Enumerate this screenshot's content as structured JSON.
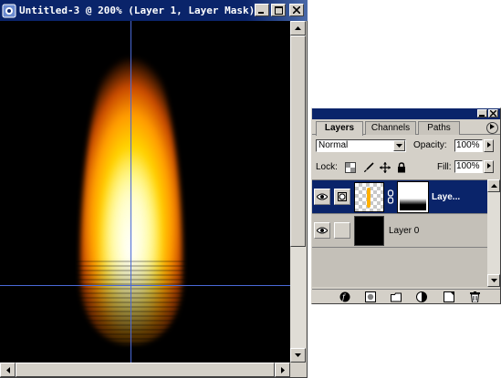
{
  "document": {
    "title": "Untitled-3 @ 200% (Layer 1, Layer Mask)",
    "minimize_glyph": "_",
    "maximize_glyph": "□",
    "close_glyph": "×"
  },
  "layers_panel": {
    "tabs": [
      {
        "label": "Layers",
        "active": true
      },
      {
        "label": "Channels",
        "active": false
      },
      {
        "label": "Paths",
        "active": false
      }
    ],
    "blend_mode": "Normal",
    "opacity_label": "Opacity:",
    "opacity_value": "100%",
    "lock_label": "Lock:",
    "fill_label": "Fill:",
    "fill_value": "100%",
    "layers": [
      {
        "name": "Laye...",
        "selected": true,
        "visible": true,
        "has_mask": true
      },
      {
        "name": "Layer 0",
        "selected": false,
        "visible": true,
        "has_mask": false
      }
    ],
    "footer_icons": [
      "layer-style-icon",
      "add-mask-icon",
      "new-set-icon",
      "adjustment-layer-icon",
      "new-layer-icon",
      "trash-icon"
    ]
  },
  "colors": {
    "titlebar": "#0a246a",
    "window_chrome": "#d4d0c8",
    "guide": "#4a6ad8",
    "selection": "#0a246a",
    "flame_orange": "#ff9a00",
    "flame_yellow": "#fff36a"
  }
}
